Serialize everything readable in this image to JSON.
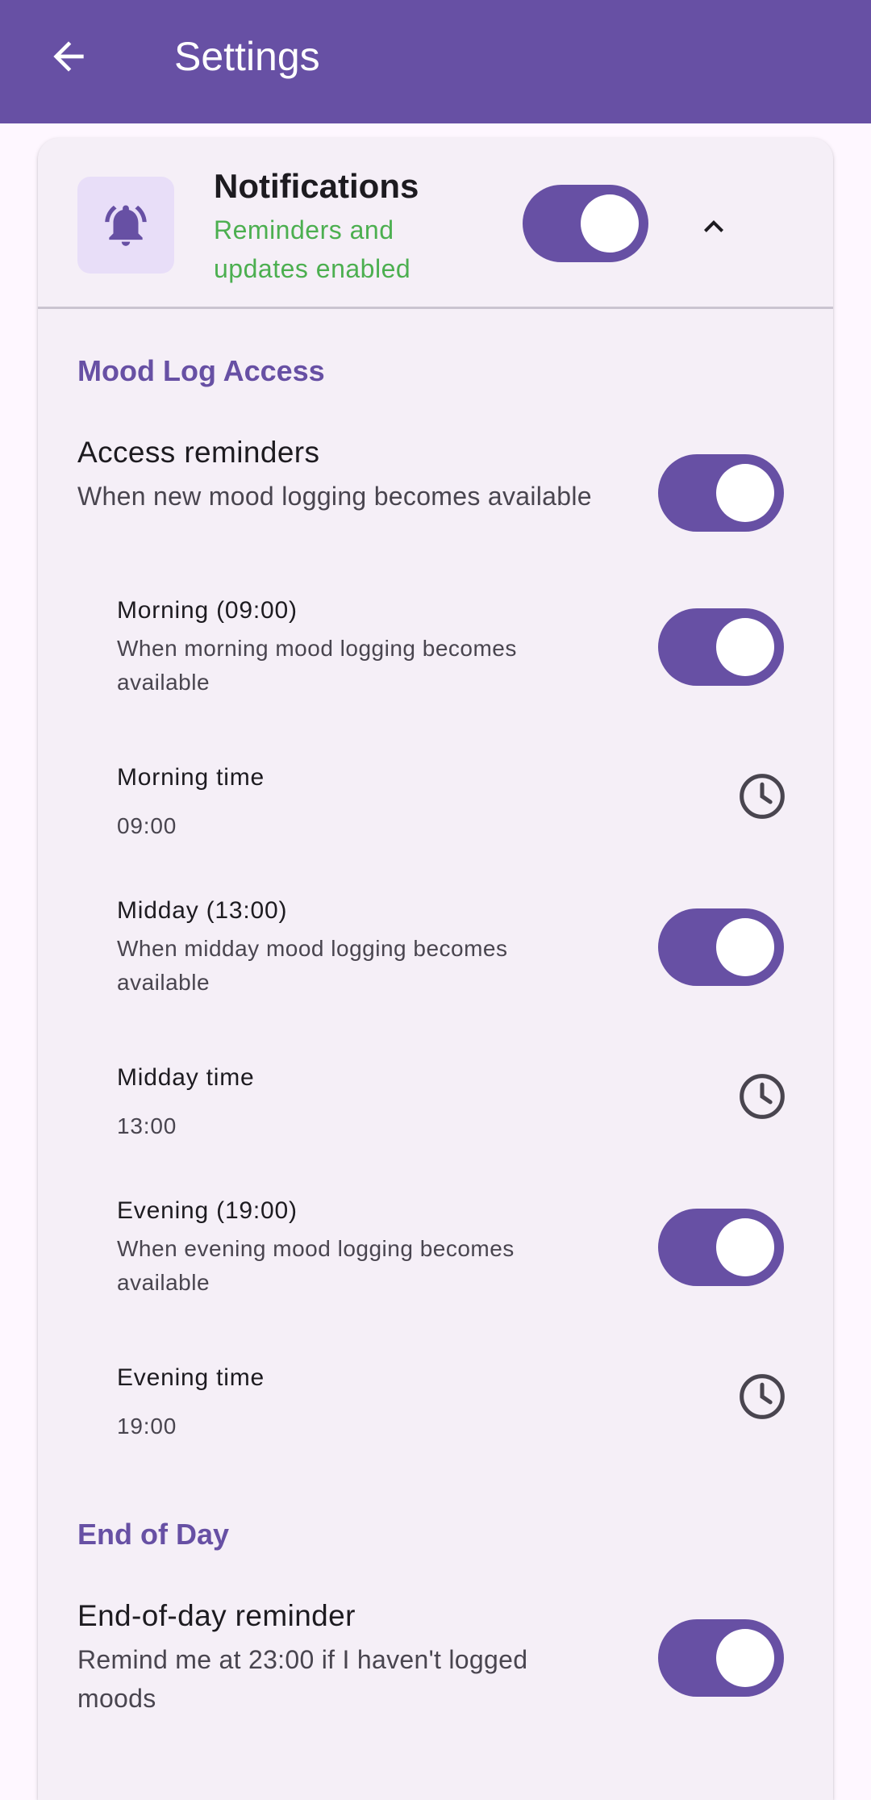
{
  "appbar": {
    "title": "Settings",
    "back_icon": "arrow-left-icon",
    "color": "#6750A4"
  },
  "notifications": {
    "title": "Notifications",
    "subtitle": "Reminders and updates enabled",
    "enabled": true,
    "icon": "bell-icon",
    "expanded": true,
    "subtitle_color": "#4CAF50"
  },
  "mood_log_access": {
    "section_title": "Mood Log Access",
    "access_reminders": {
      "title": "Access reminders",
      "subtitle": "When new mood logging becomes available",
      "enabled": true
    },
    "morning": {
      "title": "Morning (09:00)",
      "subtitle": "When morning mood logging becomes available",
      "enabled": true,
      "time_label": "Morning time",
      "time_value": "09:00"
    },
    "midday": {
      "title": "Midday (13:00)",
      "subtitle": "When midday mood logging becomes available",
      "enabled": true,
      "time_label": "Midday time",
      "time_value": "13:00"
    },
    "evening": {
      "title": "Evening (19:00)",
      "subtitle": "When evening mood logging becomes available",
      "enabled": true,
      "time_label": "Evening time",
      "time_value": "19:00"
    }
  },
  "end_of_day": {
    "section_title": "End of Day",
    "reminder": {
      "title": "End-of-day reminder",
      "subtitle": "Remind me at 23:00 if I haven't logged moods",
      "enabled": true
    }
  }
}
